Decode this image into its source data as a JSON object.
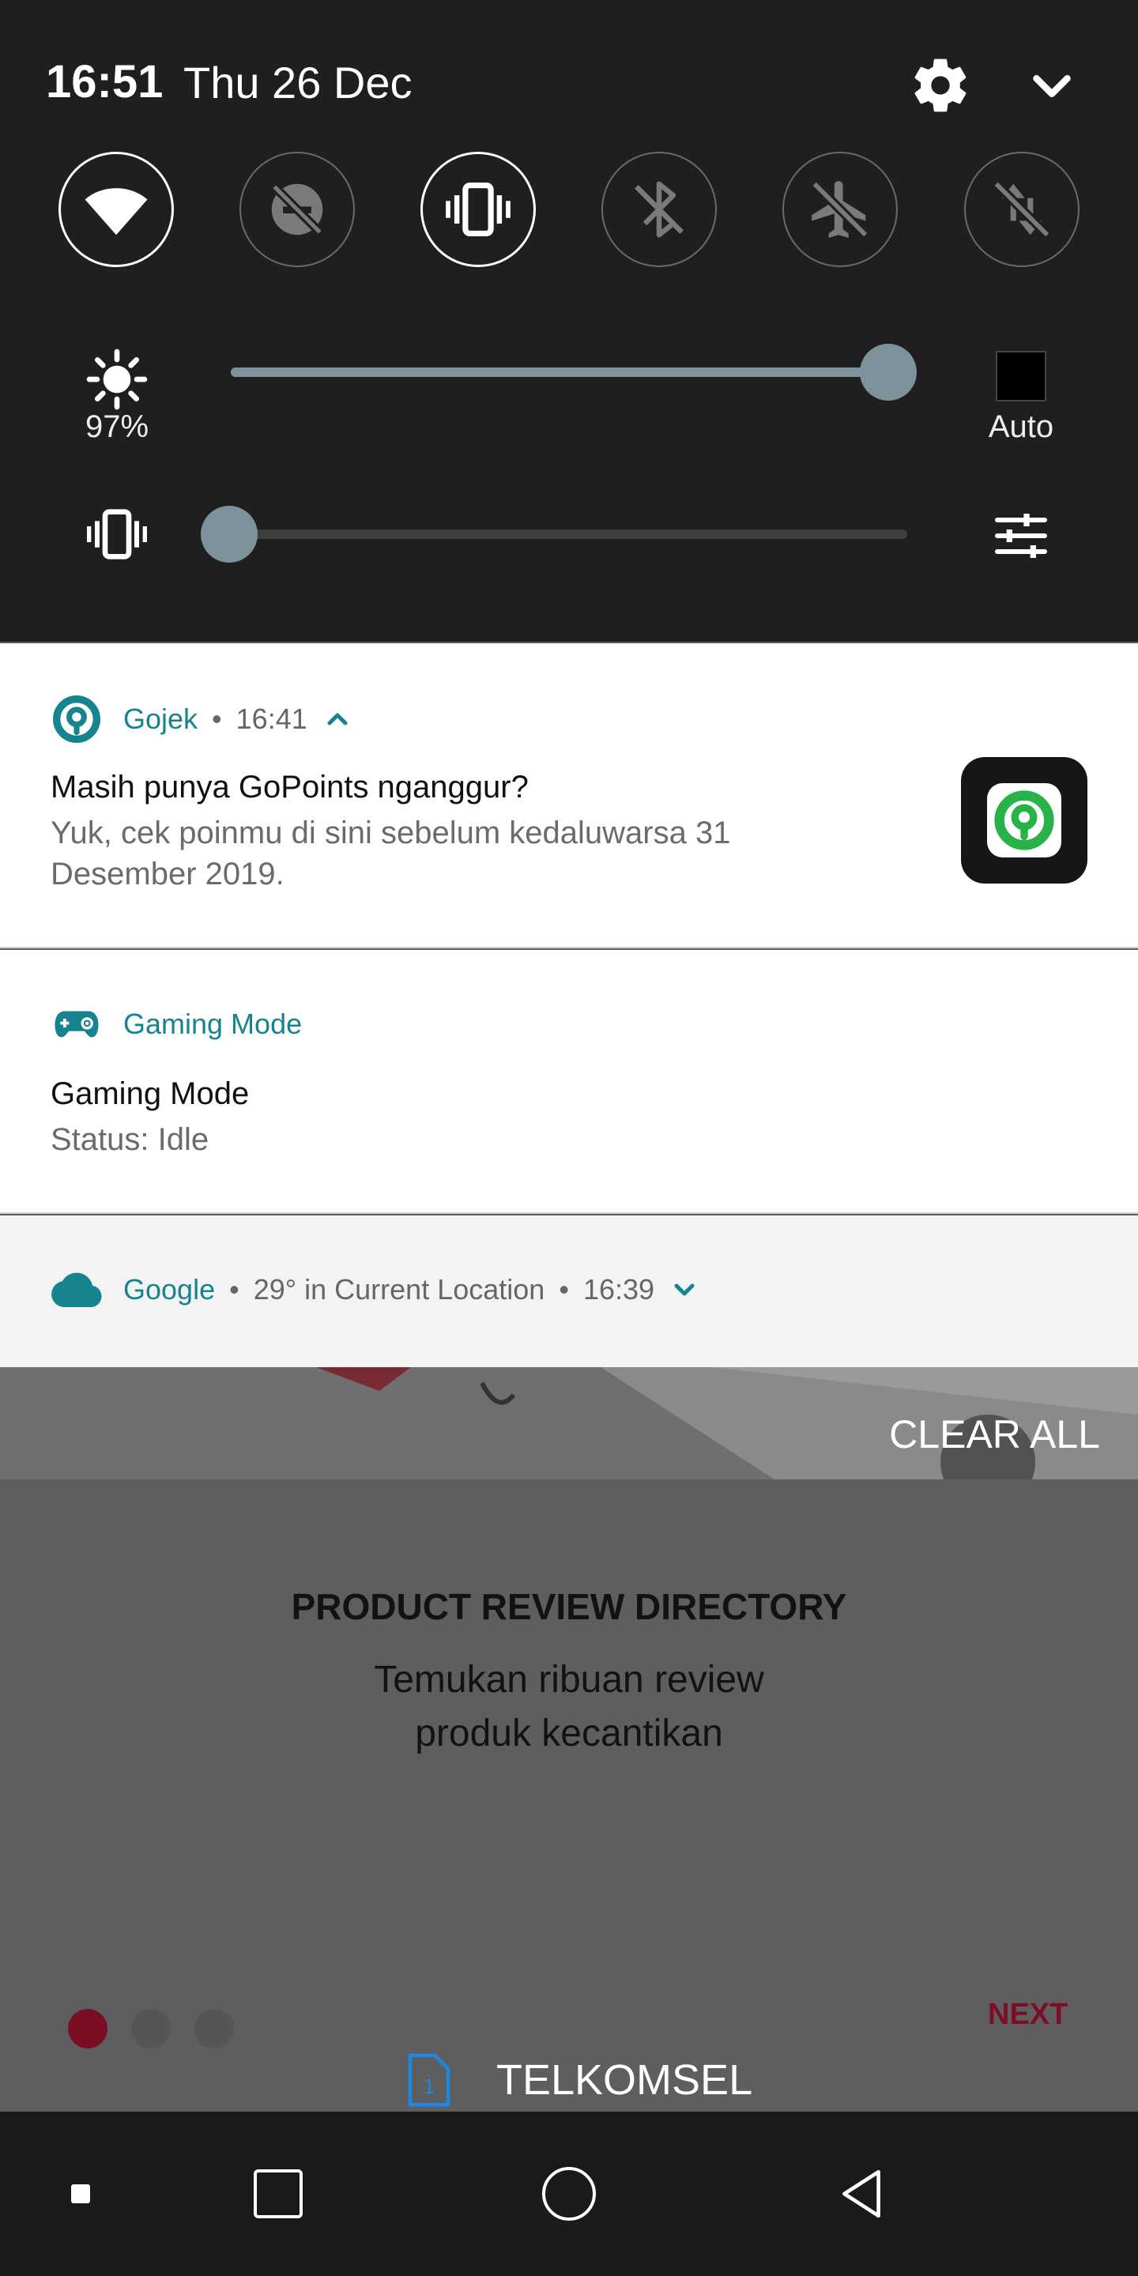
{
  "status": {
    "time": "16:51",
    "date": "Thu 26 Dec"
  },
  "quick_tiles": [
    {
      "name": "wifi",
      "state": "on"
    },
    {
      "name": "data-saver",
      "state": "off"
    },
    {
      "name": "vibrate",
      "state": "on"
    },
    {
      "name": "bluetooth",
      "state": "off"
    },
    {
      "name": "airplane-mode",
      "state": "off"
    },
    {
      "name": "mobile-data",
      "state": "off"
    }
  ],
  "brightness": {
    "label": "97%",
    "level": 0.97,
    "auto_label": "Auto"
  },
  "volume": {
    "level": 0.0
  },
  "notifications": [
    {
      "app": "Gojek",
      "time": "16:41",
      "title": "Masih punya GoPoints nganggur?",
      "text_line1": "Yuk, cek poinmu di sini sebelum kedaluwarsa 31",
      "text_line2": "Desember 2019."
    },
    {
      "app": "Gaming Mode",
      "title": "Gaming Mode",
      "text": "Status: Idle"
    },
    {
      "app": "Google",
      "summary": "29° in Current Location",
      "time": "16:39"
    }
  ],
  "clear_all_label": "CLEAR ALL",
  "background_app": {
    "title": "PRODUCT REVIEW DIRECTORY",
    "subtitle_line1": "Temukan ribuan review",
    "subtitle_line2": "produk kecantikan",
    "next_label": "NEXT",
    "page_index": 1,
    "page_count": 3
  },
  "carrier": {
    "sim_slot": "1",
    "name": "TELKOMSEL"
  },
  "colors": {
    "accent": "#16848f",
    "slider": "#7d929b",
    "next": "#7c0e24",
    "active_dot": "#7c0e24"
  }
}
